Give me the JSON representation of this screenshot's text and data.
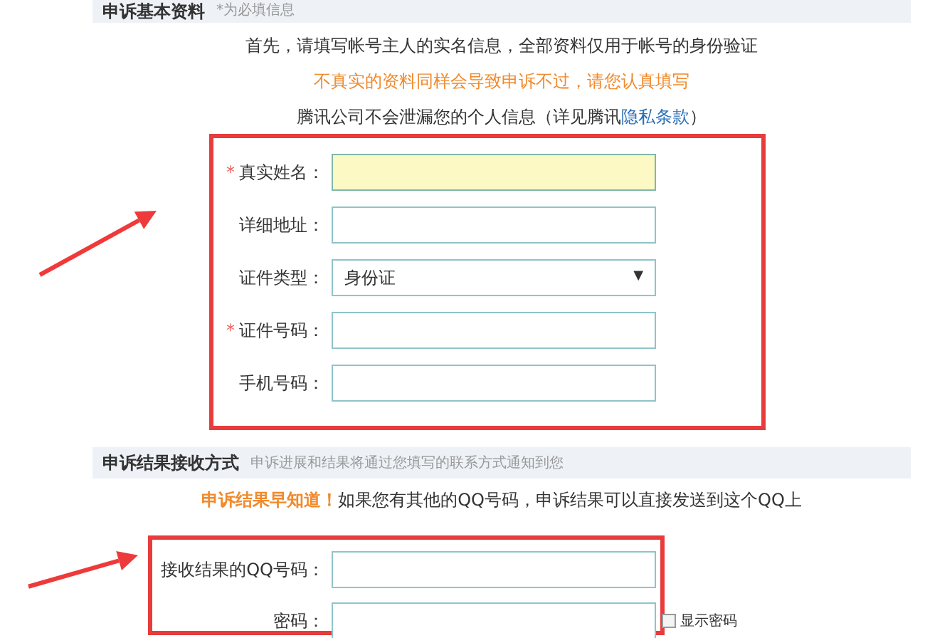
{
  "basic_section": {
    "title": "申诉基本资料",
    "note": "*为必填信息",
    "intro": "首先，请填写帐号主人的实名信息，全部资料仅用于帐号的身份验证",
    "warning": "不真实的资料同样会导致申诉不过，请您认真填写",
    "privacy": "腾讯公司不会泄漏您的个人信息（详见腾讯",
    "privacy_link": "隐私条款",
    "privacy_end": "）",
    "fields": [
      {
        "kind": "input",
        "label": "真实姓名：",
        "required_mark": "*",
        "focused": true
      },
      {
        "kind": "input",
        "label": "详细地址：",
        "focused": false
      },
      {
        "kind": "select",
        "label": "证件类型：",
        "value": "身份证",
        "caret": "▼"
      },
      {
        "kind": "input",
        "label": "证件号码：",
        "required_mark": "*",
        "focused": false
      },
      {
        "kind": "input",
        "label": "手机号码：",
        "focused": false
      }
    ]
  },
  "result_section": {
    "title": "申诉结果接收方式",
    "note": "申诉进展和结果将通过您填写的联系方式通知到您",
    "highlight": "申诉结果早知道！",
    "message": "如果您有其他的QQ号码，申诉结果可以直接发送到这个QQ上",
    "fields": [
      {
        "label": "接收结果的QQ号码："
      },
      {
        "label": "密码：",
        "checkbox_label": "显示密码",
        "checked": false
      }
    ]
  }
}
